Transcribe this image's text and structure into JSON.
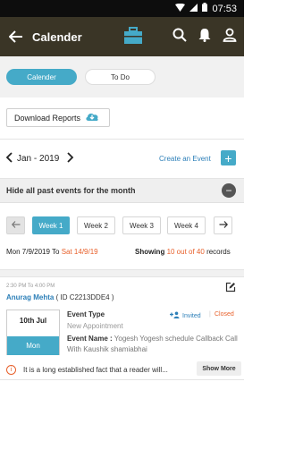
{
  "status_bar": {
    "time": "07:53"
  },
  "app_bar": {
    "title": "Calender"
  },
  "segments": {
    "active": "Calender",
    "inactive": "To Do"
  },
  "download": {
    "label": "Download Reports"
  },
  "month_nav": {
    "month": "Jan - 2019",
    "create_label": "Create an Event"
  },
  "past_events": {
    "label": "Hide all past events for the month"
  },
  "weeks": [
    "Week 1",
    "Week 2",
    "Week 3",
    "Week 4"
  ],
  "range": {
    "start": "Mon 7/9/2019",
    "to": "To",
    "end": "Sat 14/9/19",
    "showing_label": "Showing",
    "shown_count": "10 out of 40",
    "records_label": "records"
  },
  "event": {
    "time": "2:30 PM To 4:00 PM",
    "person_name": "Anurag Mehta",
    "person_id": "( ID C2213DDE4 )",
    "date": "10th  Jul",
    "day": "Mon",
    "type_label": "Event Type",
    "type_value": "New Appointment",
    "invited_label": "Invited",
    "separator": "|",
    "status": "Closed",
    "name_label": "Event Name :",
    "name_value": "Yogesh Yogesh schedule Callback Call With Kaushik shamiabhai",
    "note": "It is a long established fact that a reader will...",
    "show_more": "Show More"
  },
  "colors": {
    "appbar": "#3a3526",
    "accent": "#45aac8",
    "link": "#2c7fb8",
    "orange": "#e8612c"
  }
}
